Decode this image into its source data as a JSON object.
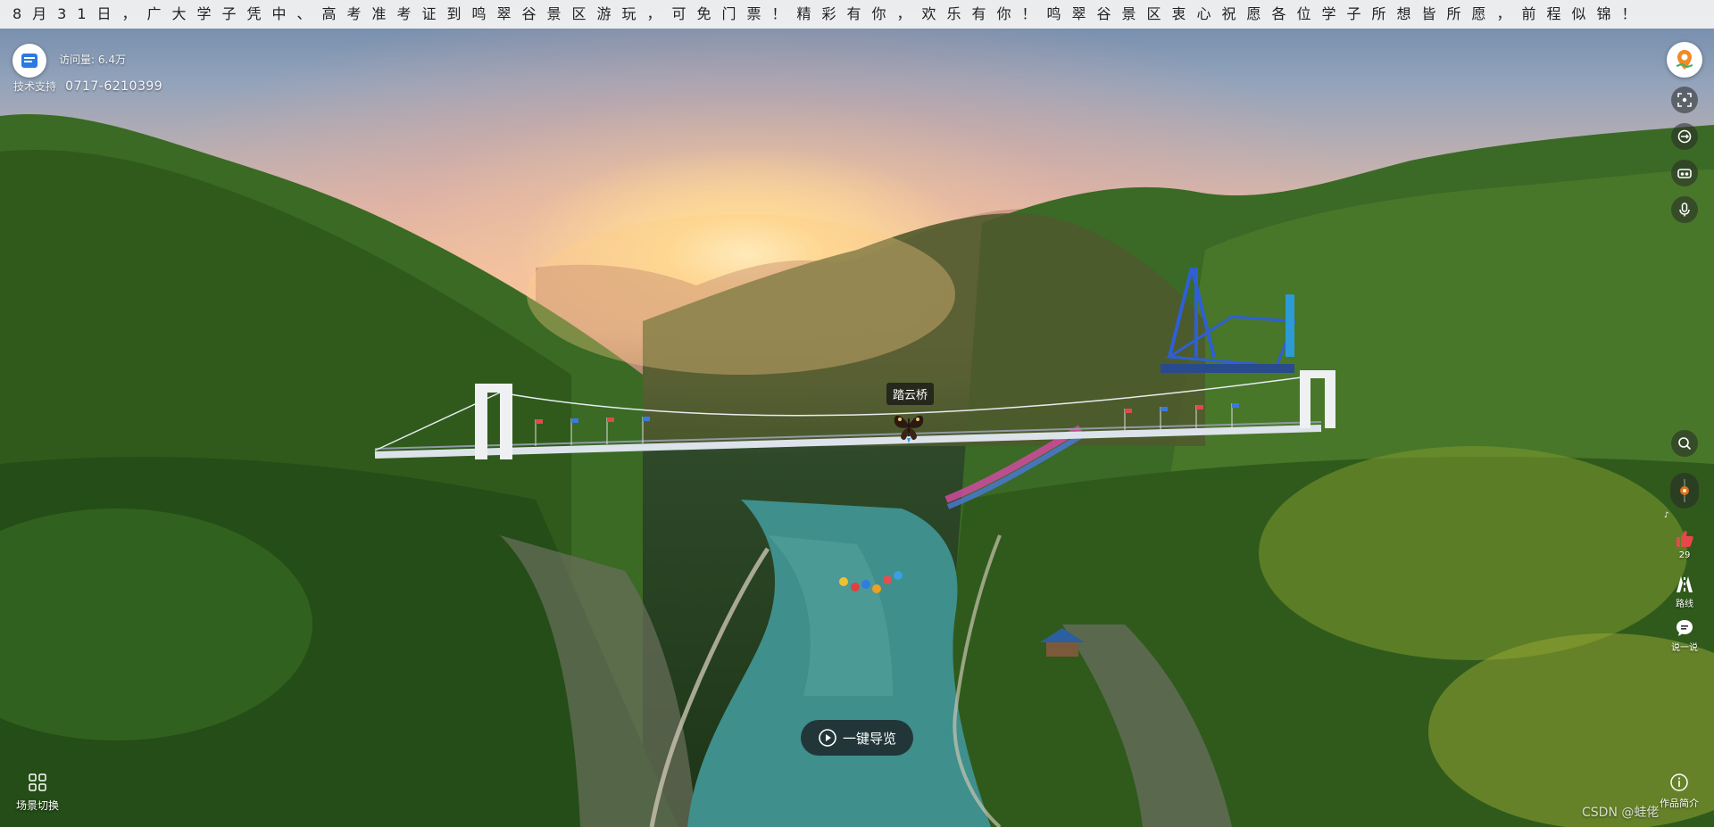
{
  "marquee": {
    "text": "8月31日，广大学子凭中、高考准考证到鸣翠谷景区游玩，可免门票！精彩有你，欢乐有你！鸣翠谷景区衷心祝愿各位学子所想皆所愿，前程似锦！"
  },
  "header": {
    "logo_icon": "logo-icon",
    "visits_label": "访问量:",
    "visits_value": "6.4万",
    "support_label": "技术支持",
    "support_phone": "0717-6210399"
  },
  "right_toolbar": {
    "map_icon": "map-pin-icon",
    "buttons": [
      {
        "icon": "focus-icon"
      },
      {
        "icon": "rotate-icon"
      },
      {
        "icon": "vr-glasses-icon"
      },
      {
        "icon": "microphone-icon"
      }
    ],
    "search_icon": "search-icon",
    "music_icon": "music-icon",
    "like": {
      "icon": "thumb-up-icon",
      "count": "29"
    },
    "route": {
      "icon": "route-icon",
      "label": "路线"
    },
    "comment": {
      "icon": "comment-icon",
      "label": "说一说"
    }
  },
  "hotspot": {
    "label": "踏云桥",
    "icon": "butterfly-icon"
  },
  "bottom": {
    "guide_label": "一键导览",
    "guide_icon": "play-circle-icon",
    "scene_switch_label": "场景切换",
    "scene_switch_icon": "grid-icon",
    "intro_label": "作品简介",
    "intro_icon": "info-icon",
    "watermark": "CSDN @蛙佬"
  },
  "colors": {
    "sun": "#fff3c8",
    "forest": "#2e5a1f",
    "water": "#3f8f8c",
    "like_red": "#e8474a"
  }
}
